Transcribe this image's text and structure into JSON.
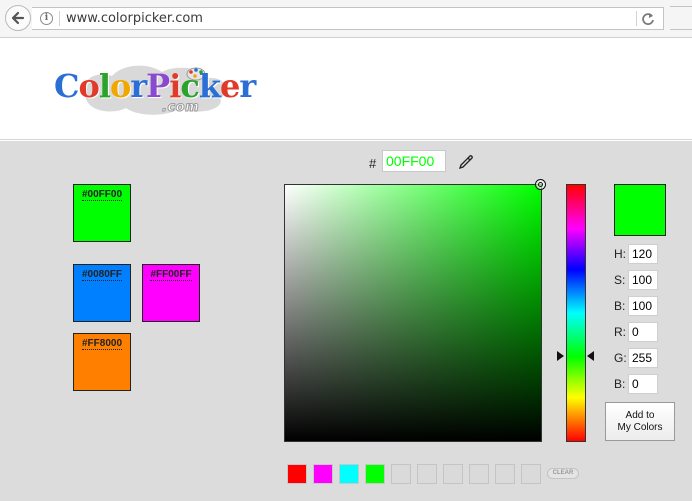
{
  "browser": {
    "url": "www.colorpicker.com"
  },
  "logo": {
    "word": [
      "C",
      "o",
      "l",
      "o",
      "r",
      "P",
      "i",
      "c",
      "k",
      "e",
      "r"
    ],
    "word_colors": [
      "#2a6ed6",
      "#e03a2a",
      "#2aa32a",
      "#f0a800",
      "#2a6ed6",
      "#8a4ad0",
      "#e03a2a",
      "#2aa32a",
      "#2a6ed6",
      "#e03a2a",
      "#2a6ed6"
    ],
    "sub": ".com"
  },
  "picker": {
    "hash": "#",
    "hex_value": "00FF00",
    "hue_color": "#00ff00",
    "current_color": "#00ff00",
    "hue_marker_fraction": 0.667,
    "fields": [
      {
        "label": "H:",
        "value": "120"
      },
      {
        "label": "S:",
        "value": "100"
      },
      {
        "label": "B:",
        "value": "100"
      },
      {
        "label": "R:",
        "value": "0"
      },
      {
        "label": "G:",
        "value": "255"
      },
      {
        "label": "B:",
        "value": "0"
      }
    ],
    "add_button_line1": "Add to",
    "add_button_line2": "My Colors",
    "clear_label": "CLEAR"
  },
  "saved_colors": [
    {
      "label": "#00FF00",
      "color": "#00ff00"
    },
    {
      "label": "#0080FF",
      "color": "#0080ff"
    },
    {
      "label": "#FF00FF",
      "color": "#ff00ff"
    },
    {
      "label": "#FF8000",
      "color": "#ff8000"
    }
  ],
  "history_colors": [
    "#ff0000",
    "#ff00ff",
    "#00ffff",
    "#00ff00",
    "",
    "",
    "",
    "",
    "",
    ""
  ]
}
